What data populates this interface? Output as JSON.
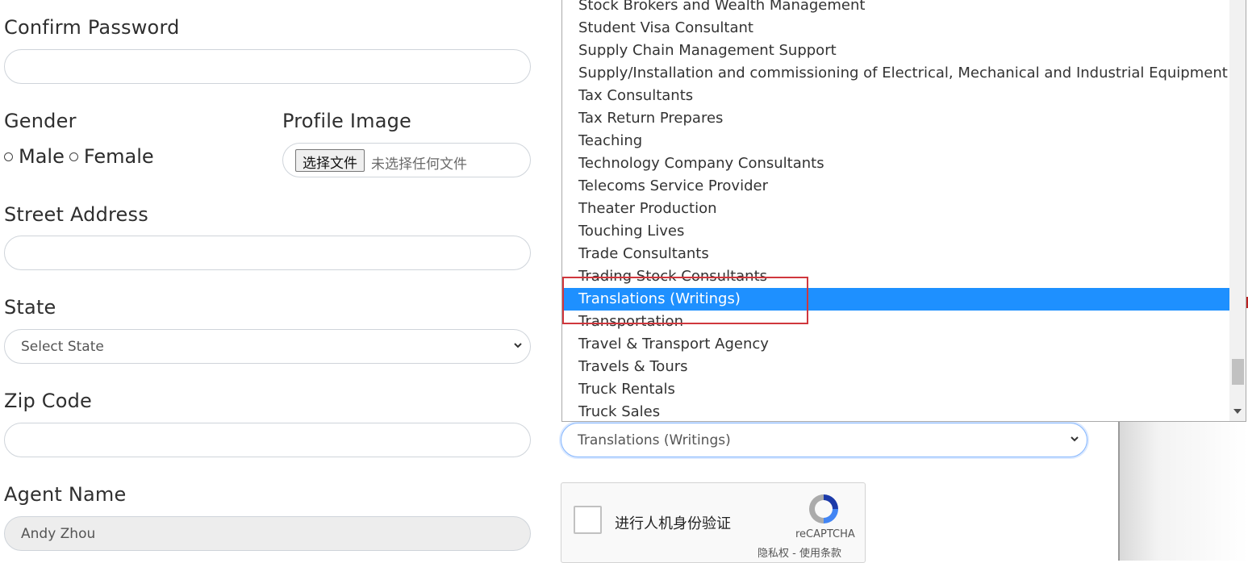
{
  "form": {
    "confirm_password_label": "Confirm Password",
    "gender_label": "Gender",
    "gender_options": [
      "Male",
      "Female"
    ],
    "profile_image_label": "Profile Image",
    "file_button_label": "选择文件",
    "file_status": "未选择任何文件",
    "street_address_label": "Street Address",
    "state_label": "State",
    "state_placeholder": "Select State",
    "zip_code_label": "Zip Code",
    "agent_name_label": "Agent Name",
    "agent_name_value": "Andy Zhou"
  },
  "category_select": {
    "selected_value": "Translations (Writings)",
    "options": [
      "Stock Brokers and Wealth Management",
      "Student Visa Consultant",
      "Supply Chain Management Support",
      "Supply/Installation and commissioning of Electrical, Mechanical and Industrial Equipment",
      "Tax Consultants",
      "Tax Return Prepares",
      "Teaching",
      "Technology Company Consultants",
      "Telecoms Service Provider",
      "Theater Production",
      "Touching Lives",
      "Trade Consultants",
      "Trading Stock Consultants",
      "Translations (Writings)",
      "Transportation",
      "Travel & Transport Agency",
      "Travels & Tours",
      "Truck Rentals",
      "Truck Sales"
    ],
    "highlighted_index": 13
  },
  "captcha": {
    "label": "进行人机身份验证",
    "brand": "reCAPTCHA",
    "links": "隐私权 - 使用条款"
  },
  "colors": {
    "selection": "#1e90ff",
    "highlight_box": "#d0373d"
  }
}
